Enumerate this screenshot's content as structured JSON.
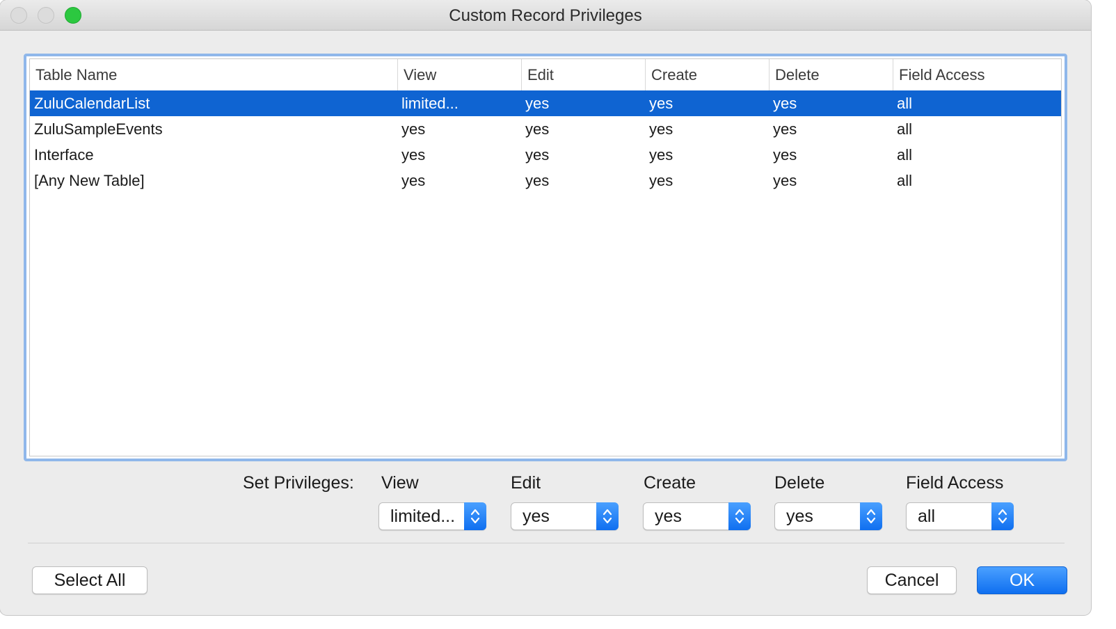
{
  "window": {
    "title": "Custom Record Privileges"
  },
  "table": {
    "columns": [
      "Table Name",
      "View",
      "Edit",
      "Create",
      "Delete",
      "Field Access"
    ],
    "rows": [
      {
        "cells": [
          "ZuluCalendarList",
          "limited...",
          "yes",
          "yes",
          "yes",
          "all"
        ],
        "selected": true
      },
      {
        "cells": [
          "ZuluSampleEvents",
          "yes",
          "yes",
          "yes",
          "yes",
          "all"
        ],
        "selected": false
      },
      {
        "cells": [
          "Interface",
          "yes",
          "yes",
          "yes",
          "yes",
          "all"
        ],
        "selected": false
      },
      {
        "cells": [
          "[Any New Table]",
          "yes",
          "yes",
          "yes",
          "yes",
          "all"
        ],
        "selected": false
      }
    ]
  },
  "set_privileges": {
    "label": "Set Privileges:",
    "view": {
      "label": "View",
      "value": "limited..."
    },
    "edit": {
      "label": "Edit",
      "value": "yes"
    },
    "create": {
      "label": "Create",
      "value": "yes"
    },
    "delete": {
      "label": "Delete",
      "value": "yes"
    },
    "field_access": {
      "label": "Field Access",
      "value": "all"
    }
  },
  "buttons": {
    "select_all": "Select All",
    "cancel": "Cancel",
    "ok": "OK"
  },
  "colors": {
    "selection": "#0f64d2",
    "focus_ring": "#8fb7ea",
    "zoom_button": "#2cc840"
  }
}
